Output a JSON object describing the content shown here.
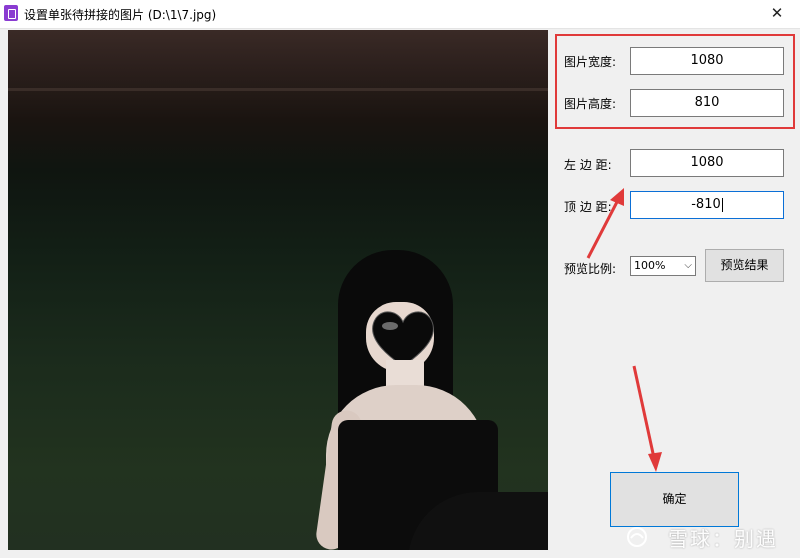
{
  "window": {
    "title": "设置单张待拼接的图片  (D:\\1\\7.jpg)",
    "close_icon": "close-icon"
  },
  "image_preview": {
    "description_icon": "photo-preview"
  },
  "size_group": {
    "width_label": "图片宽度:",
    "width_value": "1080",
    "height_label": "图片高度:",
    "height_value": "810"
  },
  "margins": {
    "left_label": "左 边 距:",
    "left_value": "1080",
    "top_label": "顶 边 距:",
    "top_value": "-810"
  },
  "preview": {
    "scale_label": "预览比例:",
    "scale_value": "100%",
    "preview_button": "预览结果"
  },
  "confirm_button": "确定",
  "watermark": "雪球：别遇",
  "colors": {
    "highlight_red": "#e03a3a",
    "focus_blue": "#0b6fd6"
  }
}
